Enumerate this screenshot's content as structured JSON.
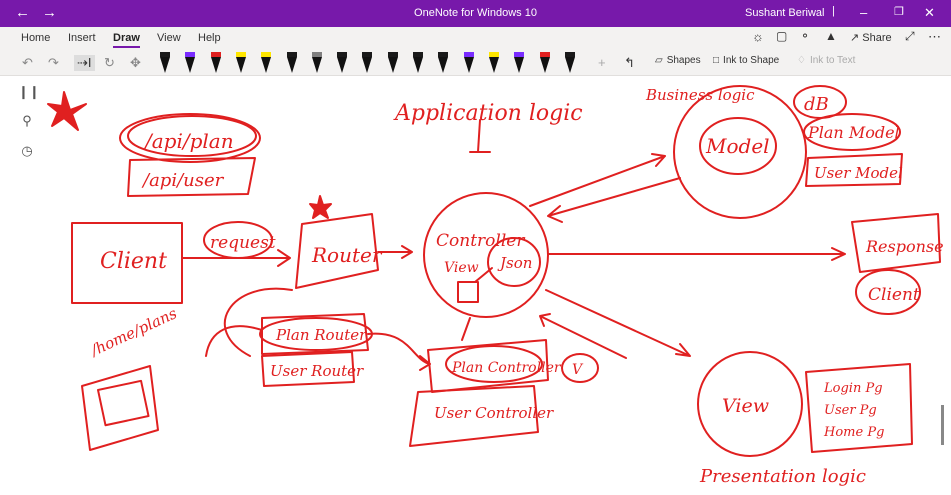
{
  "window": {
    "title": "OneNote for Windows 10",
    "user": "Sushant Beriwal"
  },
  "tabs": [
    "Home",
    "Insert",
    "Draw",
    "View",
    "Help"
  ],
  "active_tab": "Draw",
  "header_actions": {
    "share_label": "Share"
  },
  "toolbar": {
    "shapes_label": "Shapes",
    "ink_to_shape_label": "Ink to Shape",
    "ink_to_text_label": "Ink to Text"
  },
  "pens": [
    {
      "color": "#1a1a1a"
    },
    {
      "color": "#7a2cff"
    },
    {
      "color": "#e02020"
    },
    {
      "color": "#ffe600"
    },
    {
      "color": "#ffe600"
    },
    {
      "color": "#1a1a1a"
    },
    {
      "color": "#7f7f7f"
    },
    {
      "color": "#1a1a1a"
    },
    {
      "color": "#1a1a1a"
    },
    {
      "color": "#1a1a1a"
    },
    {
      "color": "#1a1a1a"
    },
    {
      "color": "#1a1a1a"
    },
    {
      "color": "#7a2cff"
    },
    {
      "color": "#ffe600"
    },
    {
      "color": "#7a2cff"
    },
    {
      "color": "#e02020"
    },
    {
      "color": "#1a1a1a"
    }
  ],
  "ink_color": "#e02020",
  "ink": {
    "application_logic": "Application logic",
    "business_logic": "Business logic",
    "db": "dB",
    "plan_model": "Plan Model",
    "user_model": "User Model",
    "model": "Model",
    "api_plan": "/api/plan",
    "api_user": "/api/user",
    "client": "Client",
    "request": "request",
    "router": "Router",
    "controller": "Controller",
    "view_small": "View",
    "json": "Json",
    "response": "Response",
    "client_small": "Client",
    "home_plans": "/home/plans",
    "plan_router": "Plan Router",
    "user_router": "User Router",
    "plan_controller": "Plan Controller",
    "user_controller": "User Controller",
    "view_circle": "View",
    "v": "V",
    "login": "Login Pg",
    "user_pg": "User Pg",
    "home_pg": "Home Pg",
    "presentation_logic": "Presentation logic"
  }
}
